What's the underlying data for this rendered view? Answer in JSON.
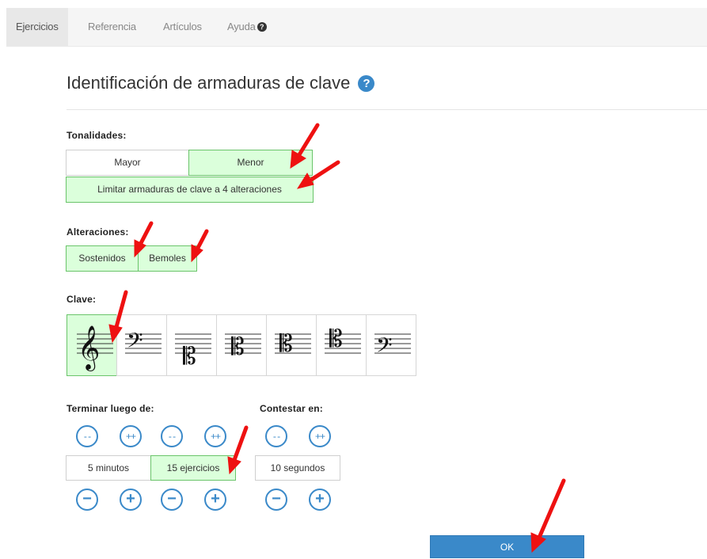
{
  "nav": {
    "tabs": [
      {
        "label": "Ejercicios",
        "active": true
      },
      {
        "label": "Referencia",
        "active": false
      },
      {
        "label": "Artículos",
        "active": false
      },
      {
        "label": "Ayuda",
        "active": false
      }
    ],
    "help_glyph": "?"
  },
  "page": {
    "title": "Identificación de armaduras de clave",
    "help_glyph": "?"
  },
  "tonalidades": {
    "label": "Tonalidades:",
    "options": [
      {
        "label": "Mayor",
        "selected": false
      },
      {
        "label": "Menor",
        "selected": true
      }
    ],
    "limit": {
      "label": "Limitar armaduras de clave a 4 alteraciones",
      "selected": true
    }
  },
  "alteraciones": {
    "label": "Alteraciones:",
    "options": [
      {
        "label": "Sostenidos",
        "selected": true
      },
      {
        "label": "Bemoles",
        "selected": true
      }
    ]
  },
  "clave": {
    "label": "Clave:",
    "options": [
      {
        "icon": "treble-clef-icon",
        "selected": true
      },
      {
        "icon": "bass-clef-icon",
        "selected": false
      },
      {
        "icon": "alto-c-clef-low-icon",
        "selected": false
      },
      {
        "icon": "c-clef-icon",
        "selected": false
      },
      {
        "icon": "c-clef-icon",
        "selected": false
      },
      {
        "icon": "c-clef-high-icon",
        "selected": false
      },
      {
        "icon": "baritone-f-clef-icon",
        "selected": false
      }
    ]
  },
  "terminar": {
    "label": "Terminar luego de:",
    "minutes": {
      "value": "5 minutos",
      "selected": false
    },
    "exercises": {
      "value": "15 ejercicios",
      "selected": true
    }
  },
  "contestar": {
    "label": "Contestar en:",
    "seconds": {
      "value": "10 segundos",
      "selected": false
    }
  },
  "steppers": {
    "big_decrement": "- -",
    "big_increment": "++",
    "decrement": "−",
    "increment": "+"
  },
  "ok_label": "OK",
  "colors": {
    "accent": "#3a89c9",
    "selected_bg": "#dbffdb",
    "selected_border": "#6ac46a",
    "annotation_arrow": "#ee1111"
  }
}
